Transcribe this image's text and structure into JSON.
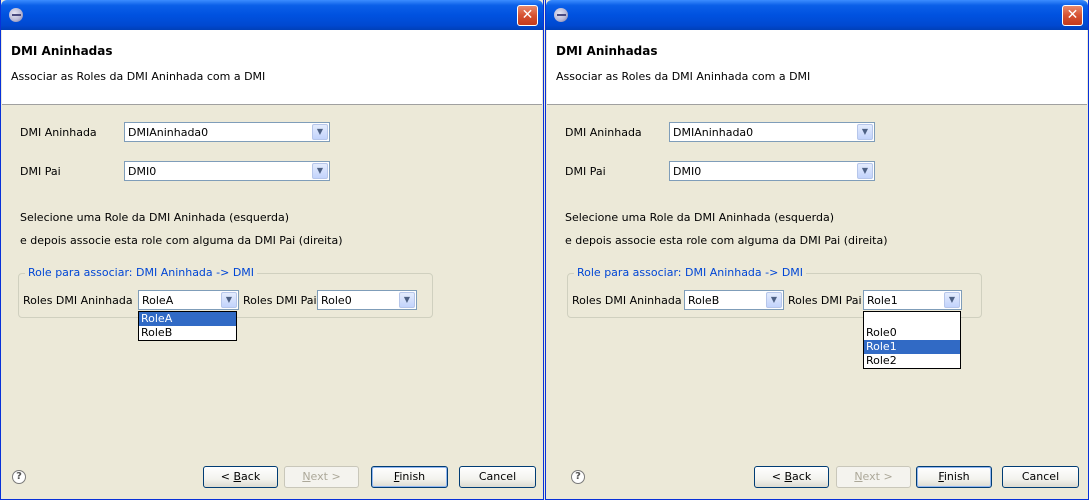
{
  "left": {
    "header_title": "DMI Aninhadas",
    "header_desc": "Associar as Roles da DMI Aninhada com a DMI",
    "dmi_aninhada_label": "DMI Aninhada",
    "dmi_aninhada_value": "DMIAninhada0",
    "dmi_pai_label": "DMI Pai",
    "dmi_pai_value": "DMI0",
    "instructions_line1": "Selecione uma Role da DMI Aninhada (esquerda)",
    "instructions_line2": "e depois associe esta role com alguma da DMI Pai (direita)",
    "group_legend": "Role para associar: DMI Aninhada -> DMI",
    "roles_aninhada_label": "Roles DMI Aninhada",
    "roles_aninhada_value": "RoleA",
    "roles_pai_label": "Roles DMI Pai",
    "roles_pai_value": "Role0",
    "open_dropdown_options": [
      "RoleA",
      "RoleB"
    ],
    "open_dropdown_selected": "RoleA"
  },
  "right": {
    "header_title": "DMI Aninhadas",
    "header_desc": "Associar as Roles da DMI Aninhada com a DMI",
    "dmi_aninhada_label": "DMI Aninhada",
    "dmi_aninhada_value": "DMIAninhada0",
    "dmi_pai_label": "DMI Pai",
    "dmi_pai_value": "DMI0",
    "instructions_line1": "Selecione uma Role da DMI Aninhada (esquerda)",
    "instructions_line2": "e depois associe esta role com alguma da DMI Pai (direita)",
    "group_legend": "Role para associar: DMI Aninhada -> DMI",
    "roles_aninhada_label": "Roles DMI Aninhada",
    "roles_aninhada_value": "RoleB",
    "roles_pai_label": "Roles DMI Pai",
    "roles_pai_value": "Role1",
    "open_dropdown_options": [
      "",
      "Role0",
      "Role1",
      "Role2"
    ],
    "open_dropdown_selected": "Role1"
  },
  "buttons": {
    "back_prefix": "< ",
    "back_mnemonic": "B",
    "back_rest": "ack",
    "next_mnemonic": "N",
    "next_rest": "ext >",
    "finish_mnemonic": "F",
    "finish_rest": "inish",
    "cancel": "Cancel"
  },
  "icons": {
    "close": "close-icon",
    "help": "help-icon",
    "dropdown": "chevron-down-icon",
    "app": "eclipse-icon"
  },
  "colors": {
    "titlebar": "#0052e0",
    "selection": "#316ac5",
    "group_legend": "#0046d5",
    "close_button": "#d65232"
  }
}
